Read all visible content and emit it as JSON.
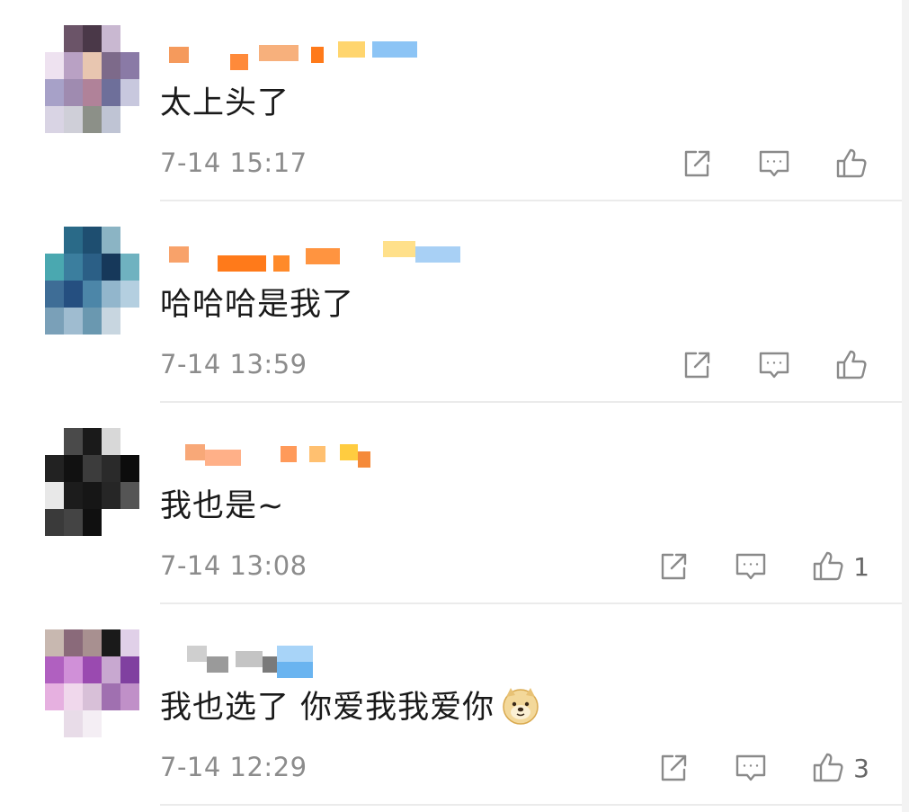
{
  "comments": [
    {
      "text": "太上头了",
      "time": "7-14 15:17",
      "likes": "",
      "avatar_colors": [
        "#ffffff",
        "#6b5468",
        "#4a3848",
        "#c9b8d1",
        "#ffffff",
        "#eee2f0",
        "#b9a1c4",
        "#e8c6b0",
        "#7d6a8a",
        "#8a7aa6",
        "#a7a1c8",
        "#9f8bb0",
        "#b08299",
        "#6e6f9a",
        "#c8c8de",
        "#d9d4e4",
        "#cfcfd8",
        "#8c9088",
        "#bfc4d4",
        "#ffffff"
      ],
      "name_colors": [
        "#f59a5c",
        "#ff8a3a",
        "#f7b07c",
        "#ff7a1a",
        "#ffd56e",
        "#8cc4f5"
      ]
    },
    {
      "text": "哈哈哈是我了",
      "time": "7-14 13:59",
      "likes": "",
      "avatar_colors": [
        "#ffffff",
        "#2a6a88",
        "#1e4e70",
        "#8bb4c4",
        "#ffffff",
        "#4aa8b0",
        "#3b7e9e",
        "#2b5f86",
        "#16385a",
        "#6fb2c0",
        "#3e6d96",
        "#254f80",
        "#4c86a8",
        "#92b6cc",
        "#b4cfe0",
        "#7aa0b8",
        "#9fbcd0",
        "#6a98b0",
        "#c8d6e0",
        "#ffffff"
      ],
      "name_colors": [
        "#f8a26a",
        "#ff7a1a",
        "#ff8a2a",
        "#ff9440",
        "#ffe08a",
        "#a8d0f5"
      ]
    },
    {
      "text": "我也是~",
      "time": "7-14 13:08",
      "likes": "1",
      "avatar_colors": [
        "#ffffff",
        "#4a4a4a",
        "#1a1a1a",
        "#d8d8d8",
        "#ffffff",
        "#222222",
        "#111111",
        "#3c3c3c",
        "#2a2a2a",
        "#0c0c0c",
        "#e8e8e8",
        "#1c1c1c",
        "#161616",
        "#262626",
        "#555555",
        "#3a3a3a",
        "#444444",
        "#101010",
        "#ffffff",
        "#ffffff"
      ],
      "name_colors": [
        "#f8a878",
        "#ffb088",
        "#ff9a5a",
        "#ffc070",
        "#ffcc40",
        "#f58a3a"
      ]
    },
    {
      "text": "我也选了 你爱我我爱你",
      "time": "7-14 12:29",
      "likes": "3",
      "avatar_colors": [
        "#c8b8b0",
        "#8a6a7a",
        "#a89090",
        "#1a1a1a",
        "#e0d0e8",
        "#b060c0",
        "#d090d8",
        "#9a4ab0",
        "#c8a8d0",
        "#8040a0",
        "#e6b0e0",
        "#f0d8ec",
        "#d8c0d8",
        "#a070b0",
        "#c090c8",
        "#ffffff",
        "#e8dce8",
        "#f4eef4",
        "#ffffff",
        "#ffffff"
      ],
      "name_colors": [
        "#cfcfcf",
        "#9a9a9a",
        "#c4c4c4",
        "#7a7a7a",
        "#a8d4f8",
        "#6ab4f0"
      ]
    }
  ]
}
